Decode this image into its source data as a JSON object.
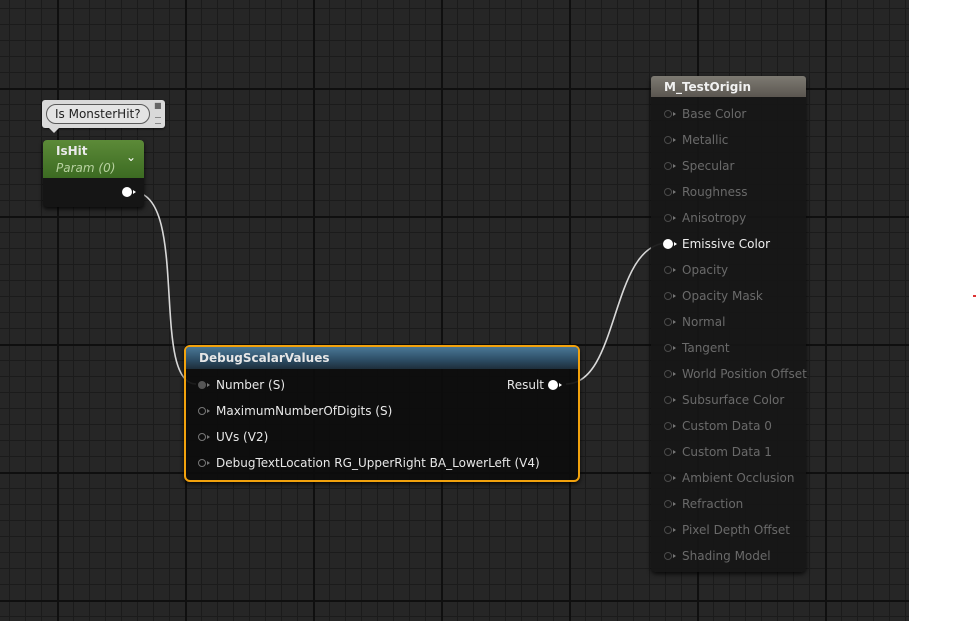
{
  "comment": {
    "text": "Is MonsterHit?"
  },
  "param_node": {
    "title": "IsHit",
    "subtitle": "Param (0)"
  },
  "debug_node": {
    "title": "DebugScalarValues",
    "inputs": [
      "Number (S)",
      "MaximumNumberOfDigits (S)",
      "UVs (V2)",
      "DebugTextLocation RG_UpperRight BA_LowerLeft (V4)"
    ],
    "output": "Result"
  },
  "material_node": {
    "title": "M_TestOrigin",
    "inputs": [
      "Base Color",
      "Metallic",
      "Specular",
      "Roughness",
      "Anisotropy",
      "Emissive Color",
      "Opacity",
      "Opacity Mask",
      "Normal",
      "Tangent",
      "World Position Offset",
      "Subsurface Color",
      "Custom Data 0",
      "Custom Data 1",
      "Ambient Occlusion",
      "Refraction",
      "Pixel Depth Offset",
      "Shading Model"
    ],
    "active_input": "Emissive Color"
  },
  "colors": {
    "graph_bg": "#262626",
    "selection": "#f2a20d",
    "param_header": "#5c8a38",
    "function_header": "#4a7896",
    "material_header": "#7d7a72"
  },
  "icons": [
    "pin-icon",
    "chevron-down-icon",
    "exec-pin-icon"
  ]
}
